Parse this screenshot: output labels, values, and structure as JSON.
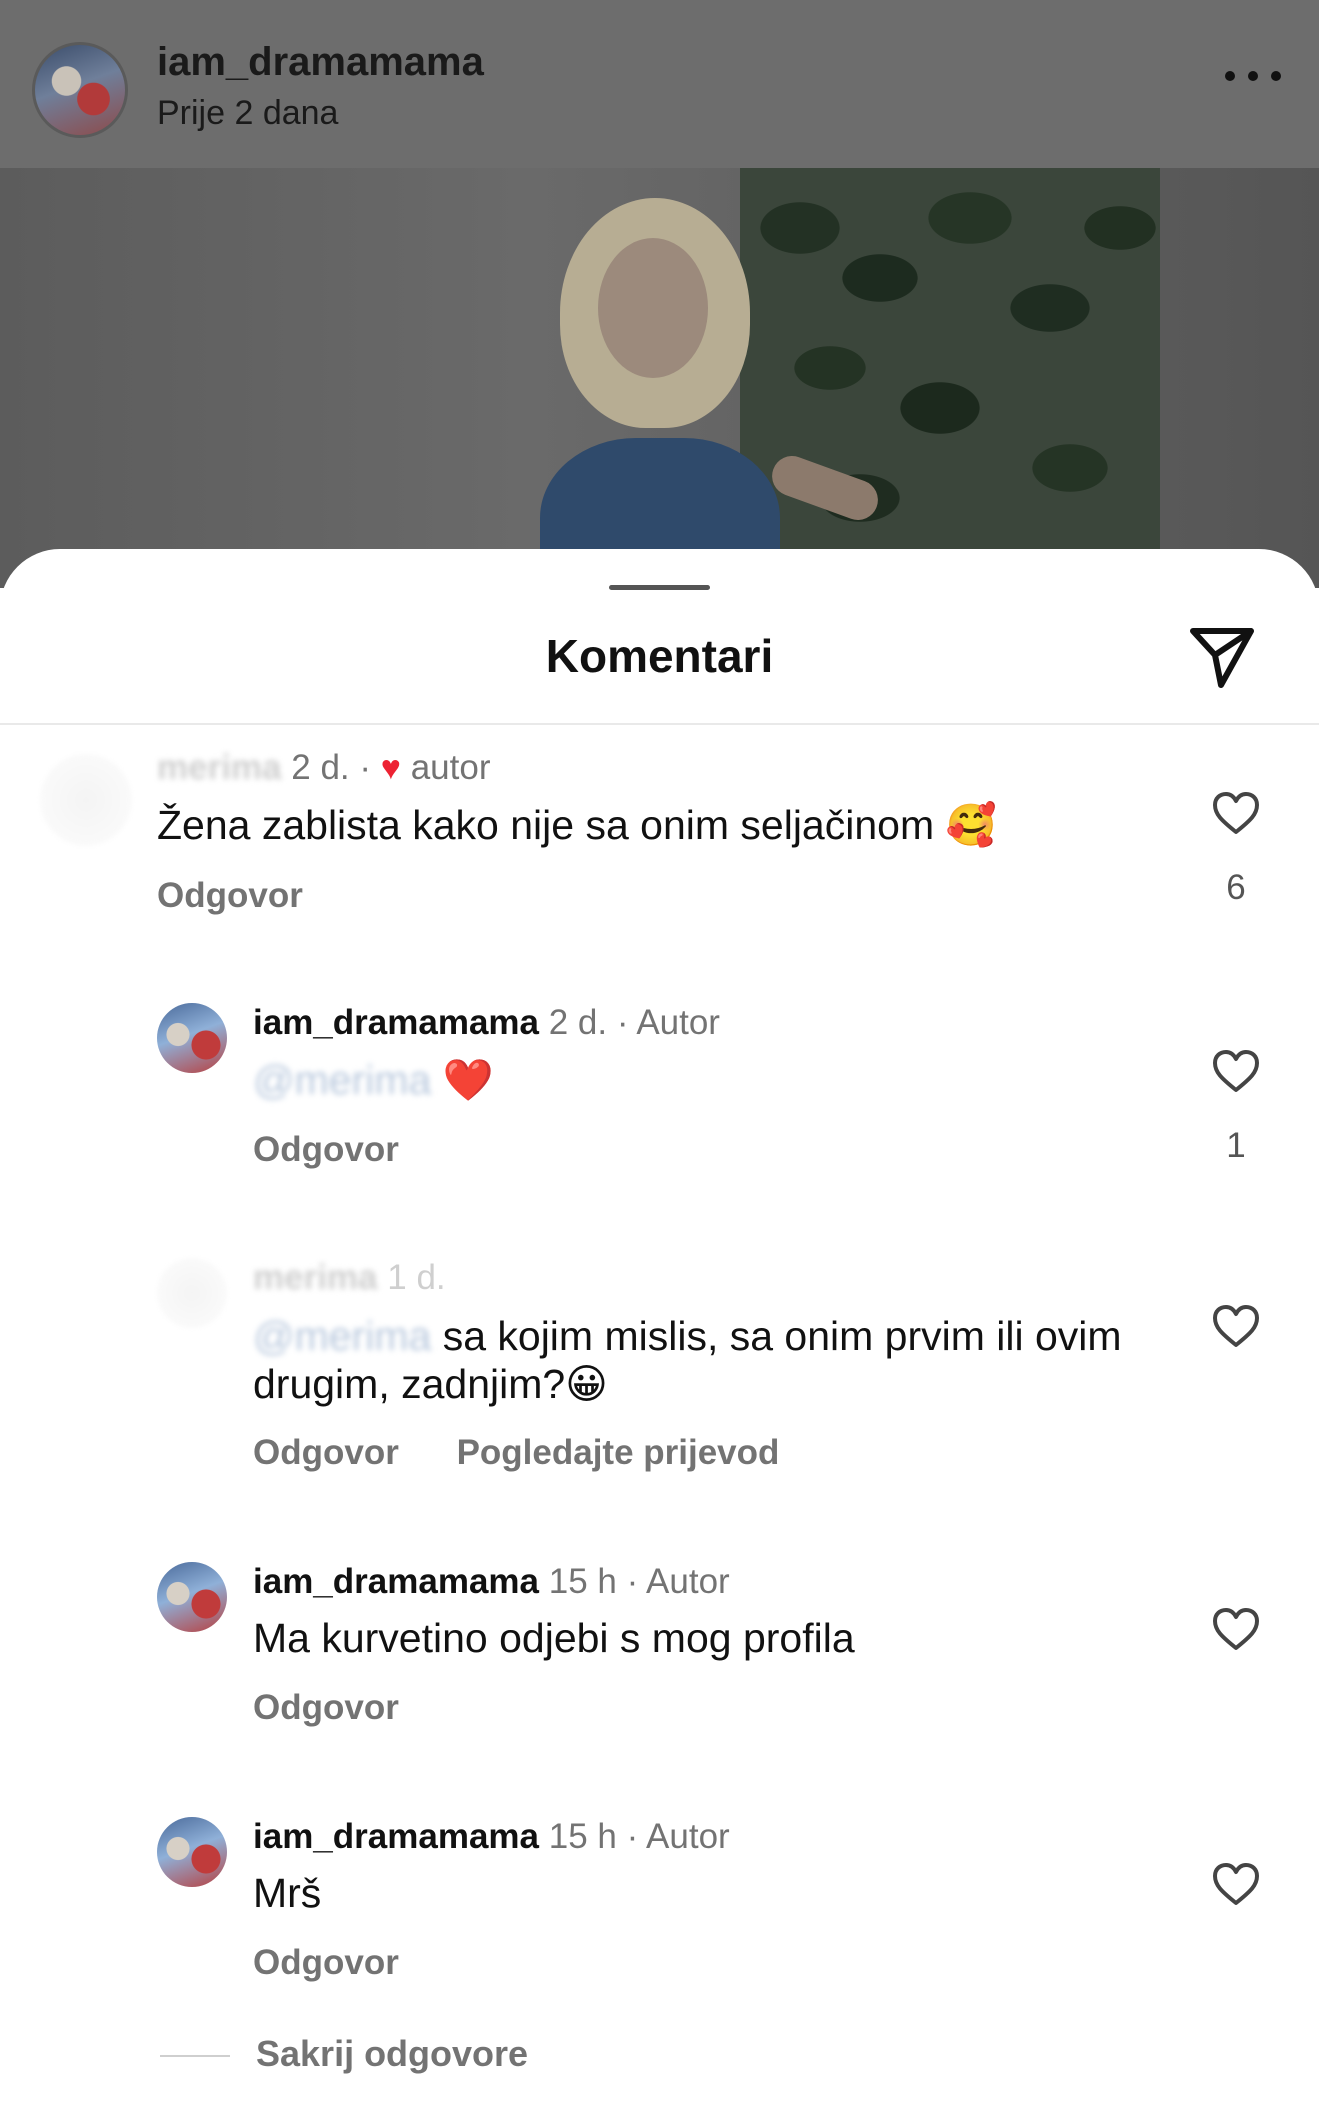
{
  "post": {
    "username": "iam_dramamama",
    "time": "Prije 2 dana"
  },
  "sheet": {
    "title": "Komentari"
  },
  "comments": [
    {
      "username": "merima",
      "time": "2 d.",
      "dot": "·",
      "heart": "♥",
      "badge": "autor",
      "text": "Žena zablista kako nije sa onim seljačinom 🥰",
      "reply": "Odgovor",
      "likes": "6"
    },
    {
      "username": "iam_dramamama",
      "time": "2 d.",
      "dot": "·",
      "badge": "Autor",
      "mention": "@merima",
      "text": "❤️",
      "reply": "Odgovor",
      "likes": "1"
    },
    {
      "username": "merima",
      "time": "1 d.",
      "mention": "@merima",
      "text": "sa kojim mislis, sa onim prvim ili ovim drugim, zadnjim?😀",
      "reply": "Odgovor",
      "translate": "Pogledajte prijevod"
    },
    {
      "username": "iam_dramamama",
      "time": "15 h",
      "dot": "·",
      "badge": "Autor",
      "text": "Ma kurvetino odjebi s mog profila",
      "reply": "Odgovor"
    },
    {
      "username": "iam_dramamama",
      "time": "15 h",
      "dot": "·",
      "badge": "Autor",
      "text": "Mrš",
      "reply": "Odgovor"
    }
  ],
  "footer": {
    "hide_replies": "Sakrij odgovore"
  },
  "icons": {
    "more": "more-icon",
    "share": "paper-plane-icon",
    "like": "heart-outline-icon"
  },
  "colors": {
    "author_heart": "#ed2233",
    "muted_text": "#737373"
  }
}
